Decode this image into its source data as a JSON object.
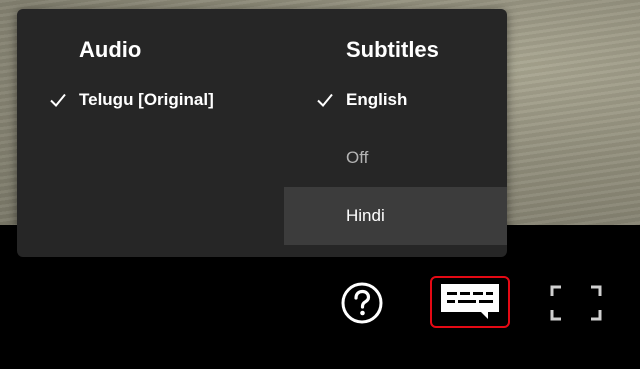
{
  "menu": {
    "audio": {
      "heading": "Audio",
      "options": [
        {
          "label": "Telugu [Original]",
          "selected": true
        }
      ]
    },
    "subtitles": {
      "heading": "Subtitles",
      "options": [
        {
          "label": "English",
          "selected": true
        },
        {
          "label": "Off",
          "selected": false
        },
        {
          "label": "Hindi",
          "selected": false,
          "hovered": true
        }
      ]
    }
  },
  "controls": {
    "help_icon": "question-circle-icon",
    "subtitles_icon": "subtitles-bubble-icon",
    "fullscreen_icon": "fullscreen-icon",
    "active_color": "#e50914"
  }
}
